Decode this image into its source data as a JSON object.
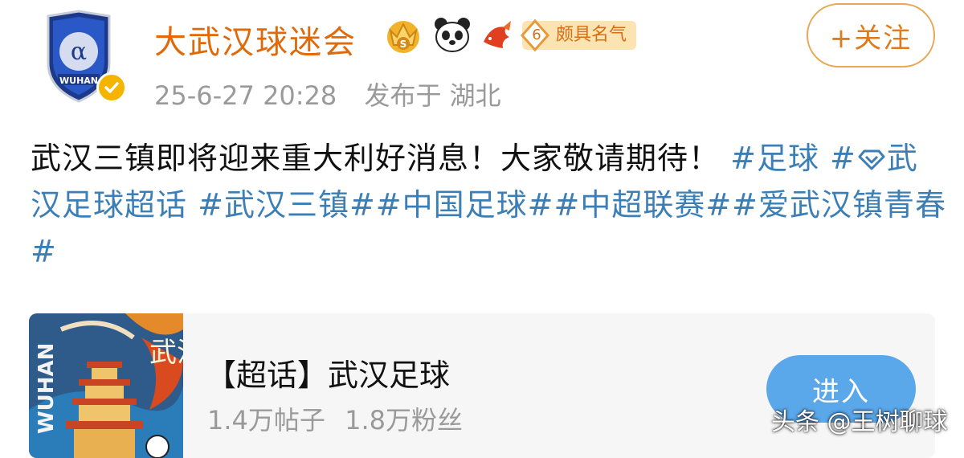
{
  "post": {
    "author": {
      "name": "大武汉球迷会",
      "avatar_icon": "wuhan-club-crest-icon",
      "avatar_text": "WUHAN",
      "verified_icon": "verified-check-icon",
      "badges": [
        "crown-badge-icon",
        "panda-badge-icon",
        "fish-badge-icon"
      ],
      "level_number": "6",
      "level_label": "颇具名气"
    },
    "follow_label": "+关注",
    "timestamp": "25-6-27 20:28",
    "location": "发布于 湖北",
    "content": {
      "text": "武汉三镇即将迎来重大利好消息！大家敬请期待！",
      "tags": [
        "#足球",
        "#",
        "武汉足球超话",
        " #武汉三镇#",
        "#中国足球#",
        "#中超联赛#",
        "#爱武汉镇青春#"
      ]
    }
  },
  "topic_card": {
    "thumb_text_left": "WUHAN",
    "thumb_text_right": "武汉",
    "title": "【超话】武汉足球",
    "posts": "1.4万帖子",
    "fans": "1.8万粉丝",
    "enter_label": "进入"
  },
  "watermark": "头条 @王树聊球",
  "colors": {
    "username": "#e0690a",
    "tag": "#3c7fb6",
    "follow_border": "#e8a855",
    "enter_button": "#5aa7ea"
  }
}
